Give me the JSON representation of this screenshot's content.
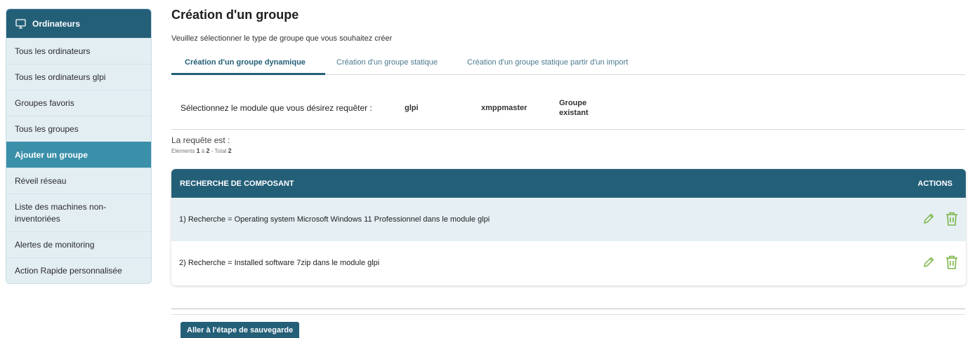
{
  "sidebar": {
    "header": "Ordinateurs",
    "header_icon": "monitor-icon",
    "items": [
      {
        "label": "Tous les ordinateurs"
      },
      {
        "label": "Tous les ordinateurs glpi"
      },
      {
        "label": "Groupes favoris"
      },
      {
        "label": "Tous les groupes"
      },
      {
        "label": "Ajouter un groupe",
        "active": true
      },
      {
        "label": "Réveil réseau"
      },
      {
        "label": "Liste des machines non-inventoriées"
      },
      {
        "label": "Alertes de monitoring"
      },
      {
        "label": "Action Rapide personnalisée"
      }
    ]
  },
  "main": {
    "title": "Création d'un groupe",
    "subtitle": "Veuillez sélectionner le type de groupe que vous souhaitez créer",
    "tabs": [
      {
        "label": "Création d'un groupe dynamique",
        "active": true
      },
      {
        "label": "Création d'un groupe statique"
      },
      {
        "label": "Création d'un groupe statique partir d'un import"
      }
    ],
    "module_select": {
      "label": "Sélectionnez le module que vous désirez requêter :",
      "options": [
        "glpi",
        "xmppmaster",
        "Groupe existant"
      ]
    },
    "request_label": "La requête est :",
    "elements": {
      "prefix": "Elements",
      "from": "1",
      "sep": "à",
      "to": "2",
      "total_label": "- Total",
      "total": "2"
    },
    "table": {
      "headers": {
        "component": "RECHERCHE DE COMPOSANT",
        "actions": "ACTIONS"
      },
      "rows": [
        {
          "text": "1) Recherche = Operating system Microsoft Windows 11 Professionnel dans le module glpi"
        },
        {
          "text": "2) Recherche = Installed software 7zip dans le module glpi"
        }
      ]
    },
    "save_button": "Aller à l'étape de sauvegarde"
  },
  "colors": {
    "primary": "#245f78",
    "active_item": "#3a8fa9",
    "action_green": "#7ab648",
    "sidebar_bg": "#e3eef3"
  }
}
